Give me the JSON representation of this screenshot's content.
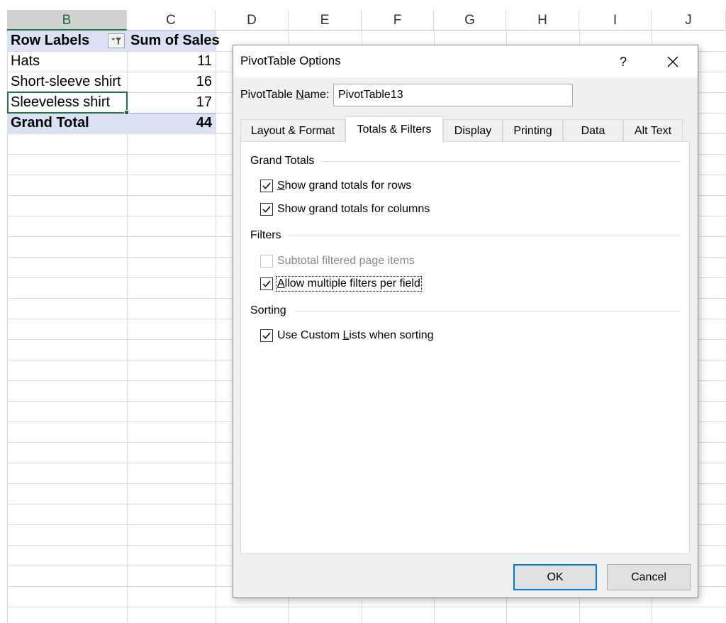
{
  "sheet": {
    "columns": [
      "B",
      "C",
      "D",
      "E",
      "F",
      "G",
      "H",
      "I",
      "J"
    ],
    "selected_column": "B",
    "pivot": {
      "header_row_label": "Row Labels",
      "header_value_label": "Sum of Sales",
      "rows": [
        {
          "label": "Hats",
          "value": "11"
        },
        {
          "label": "Short-sleeve shirt",
          "value": "16"
        },
        {
          "label": "Sleeveless shirt",
          "value": "17"
        }
      ],
      "total_label": "Grand Total",
      "total_value": "44"
    },
    "filter_icon": "filter-dropdown-icon"
  },
  "dialog": {
    "title": "PivotTable Options",
    "help_label": "?",
    "close_label": "✕",
    "name_label_pre": "PivotTable ",
    "name_label_accel": "N",
    "name_label_post": "ame:",
    "name_value": "PivotTable13",
    "tabs": [
      "Layout & Format",
      "Totals & Filters",
      "Display",
      "Printing",
      "Data",
      "Alt Text"
    ],
    "active_tab": "Totals & Filters",
    "groups": {
      "grand_totals": "Grand Totals",
      "filters": "Filters",
      "sorting": "Sorting"
    },
    "options": {
      "rows": {
        "pre": "",
        "accel": "S",
        "post": "how grand totals for rows",
        "checked": true
      },
      "columns": {
        "pre": "Show ",
        "accel": "g",
        "post": "rand totals for columns",
        "checked": true
      },
      "subtotal": {
        "pre": "Subtotal filtered page items",
        "accel": "",
        "post": "",
        "checked": false,
        "disabled": true
      },
      "multiple": {
        "pre": "",
        "accel": "A",
        "post": "llow multiple filters per field",
        "checked": true
      },
      "custom_lists": {
        "pre": "Use Custom ",
        "accel": "L",
        "post": "ists when sorting",
        "checked": true
      }
    },
    "ok_label": "OK",
    "cancel_label": "Cancel"
  },
  "colors": {
    "pivot_header_bg": "#dae1f2",
    "selection_green": "#217346",
    "default_button_border": "#0078d7"
  }
}
